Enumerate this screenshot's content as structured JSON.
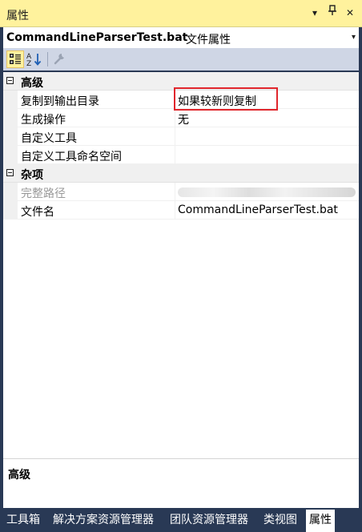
{
  "window": {
    "title": "属性",
    "dropdown_glyph": "▾",
    "pin_glyph": "⊥",
    "close_glyph": "✕"
  },
  "selector": {
    "object_name": "CommandLineParserTest.bat",
    "object_type": "文件属性",
    "arrow": "▾"
  },
  "toolbar": {
    "icons": [
      "categorized-icon",
      "alphabetical-icon",
      "property-pages-icon"
    ]
  },
  "grid": {
    "categories": [
      {
        "label": "高级",
        "properties": [
          {
            "name": "复制到输出目录",
            "value": "如果较新则复制",
            "highlighted": true
          },
          {
            "name": "生成操作",
            "value": "无"
          },
          {
            "name": "自定义工具",
            "value": ""
          },
          {
            "name": "自定义工具命名空间",
            "value": ""
          }
        ]
      },
      {
        "label": "杂项",
        "properties": [
          {
            "name": "完整路径",
            "value": "",
            "disabled": true,
            "obscured": true
          },
          {
            "name": "文件名",
            "value": "CommandLineParserTest.bat"
          }
        ]
      }
    ]
  },
  "description": {
    "title": "高级"
  },
  "tabs": [
    {
      "label": "工具箱",
      "active": false
    },
    {
      "label": "解决方案资源管理器",
      "active": false
    },
    {
      "label": "团队资源管理器",
      "active": false
    },
    {
      "label": "类视图",
      "active": false
    },
    {
      "label": "属性",
      "active": true
    }
  ],
  "colors": {
    "title_bar": "#FFF29D",
    "frame": "#293955",
    "toolbar": "#CFD6E5",
    "highlight_box": "#E0262C"
  }
}
